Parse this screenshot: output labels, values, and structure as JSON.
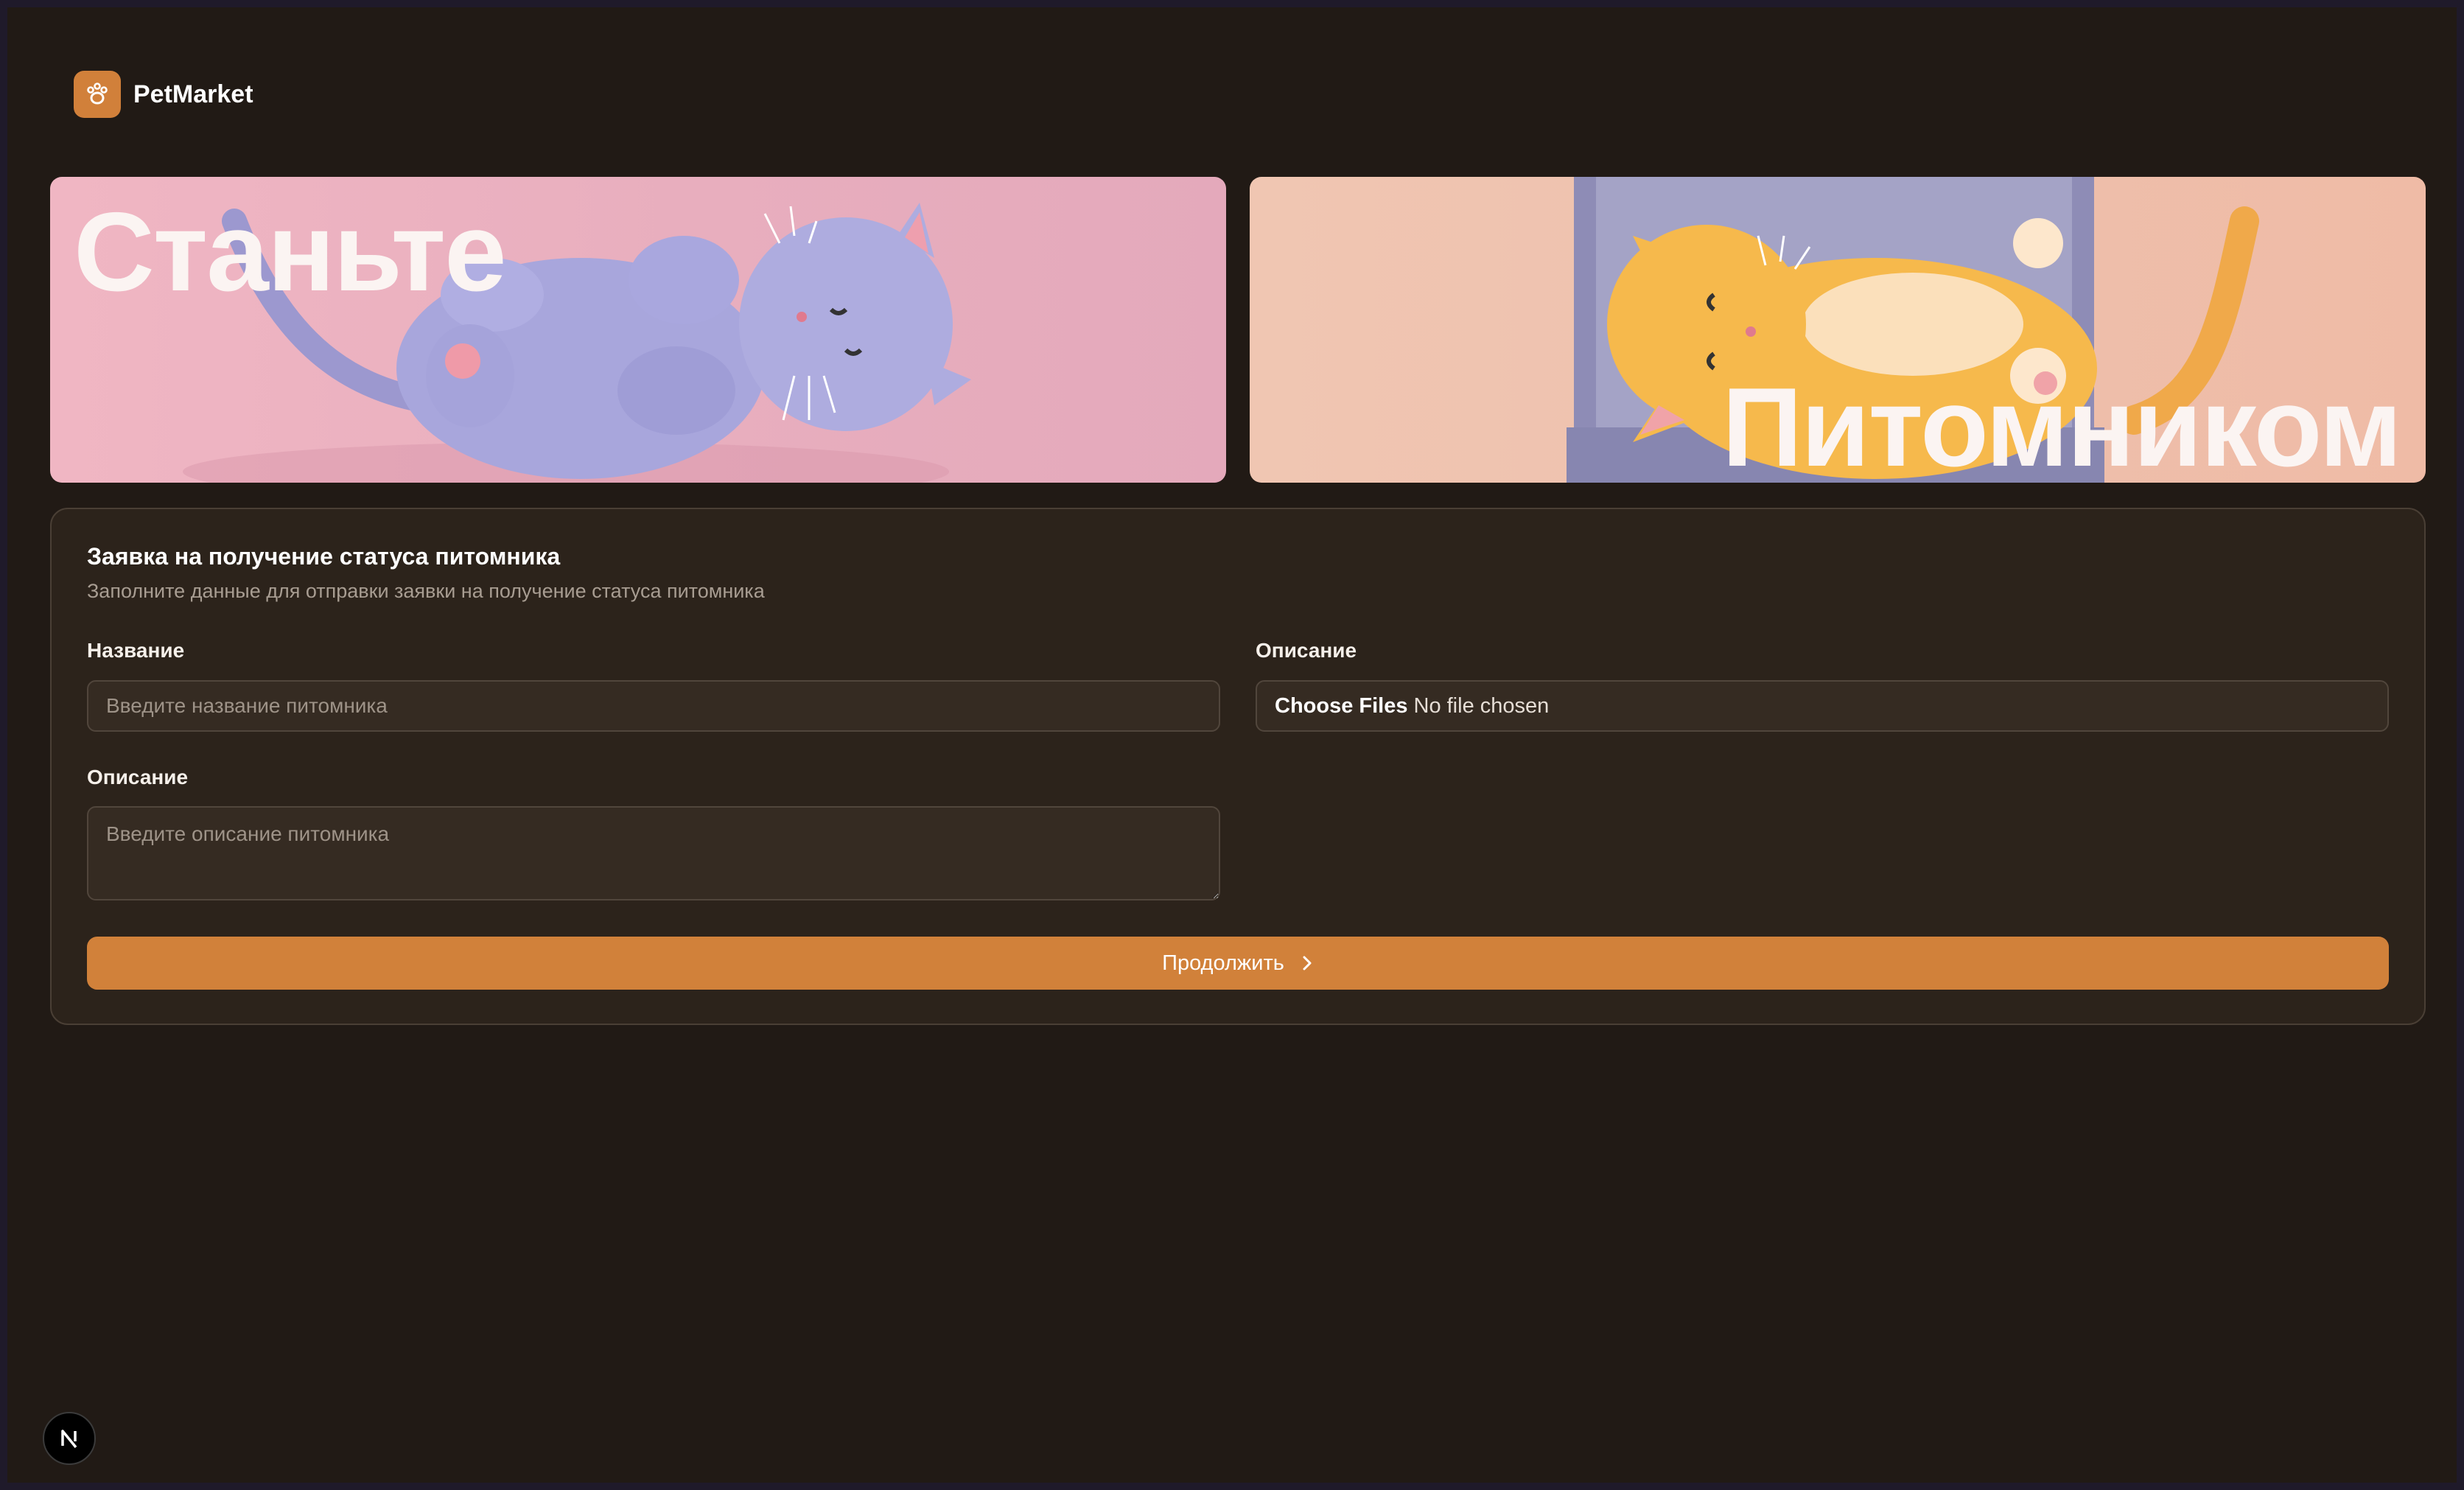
{
  "app": {
    "name": "PetMarket",
    "logo_icon": "paw-icon",
    "accent_color": "#d1803a"
  },
  "banners": {
    "left": {
      "text": "Станьте",
      "image": "sleeping-blue-cat-illustration"
    },
    "right": {
      "text": "Питомником",
      "image": "sleeping-orange-cat-illustration"
    }
  },
  "form": {
    "title": "Заявка на получение статуса питомника",
    "subtitle": "Заполните данные для отправки заявки на получение статуса питомника",
    "name_label": "Название",
    "name_placeholder": "Введите название питомника",
    "file_label": "Описание",
    "file_button": "Choose Files",
    "file_status": "No file chosen",
    "description_label": "Описание",
    "description_placeholder": "Введите описание питомника",
    "submit_label": "Продолжить",
    "submit_icon": "chevron-right-icon"
  },
  "dev_badge": {
    "icon": "nextjs-icon",
    "letter": "N"
  }
}
